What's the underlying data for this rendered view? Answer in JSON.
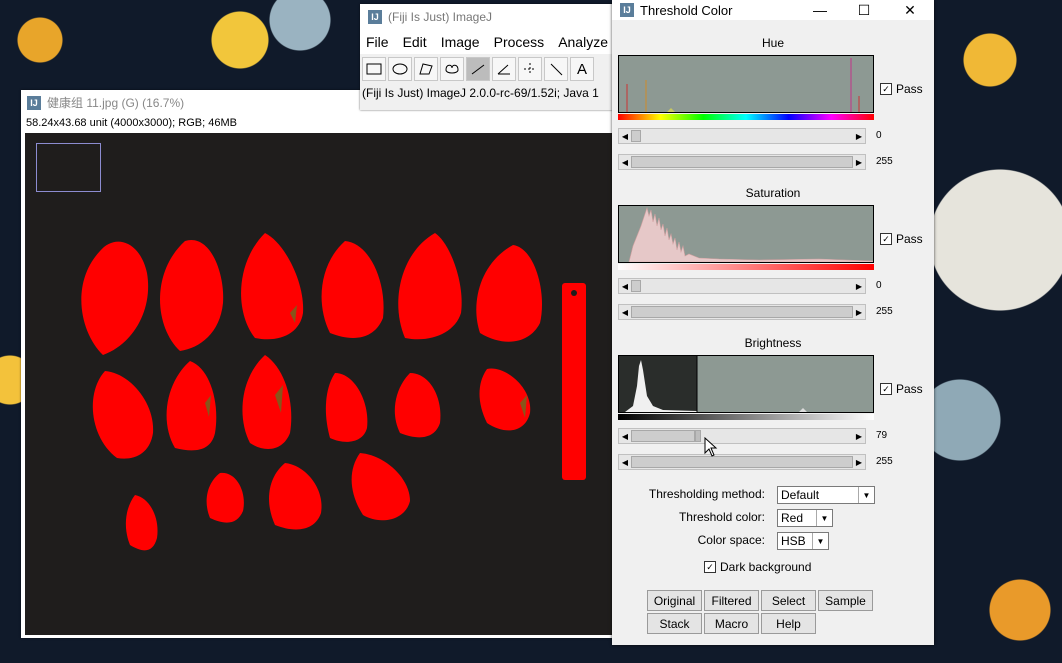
{
  "image_window": {
    "title": "健康组 11.jpg (G) (16.7%)",
    "info": "58.24x43.68 unit (4000x3000); RGB; 46MB"
  },
  "imagej_window": {
    "title": "(Fiji Is Just) ImageJ",
    "menu": [
      "File",
      "Edit",
      "Image",
      "Process",
      "Analyze"
    ],
    "status": "(Fiji Is Just) ImageJ 2.0.0-rc-69/1.52i; Java 1"
  },
  "threshold_window": {
    "title": "Threshold Color",
    "hue": {
      "label": "Hue",
      "min": "0",
      "max": "255",
      "pass_label": "Pass",
      "pass": true
    },
    "saturation": {
      "label": "Saturation",
      "min": "0",
      "max": "255",
      "pass_label": "Pass",
      "pass": true
    },
    "brightness": {
      "label": "Brightness",
      "min": "79",
      "max": "255",
      "pass_label": "Pass",
      "pass": true
    },
    "method_label": "Thresholding method:",
    "method_value": "Default",
    "color_label": "Threshold color:",
    "color_value": "Red",
    "space_label": "Color space:",
    "space_value": "HSB",
    "dark_bg_label": "Dark background",
    "dark_bg": true,
    "buttons_row1": [
      "Original",
      "Filtered",
      "Select",
      "Sample"
    ],
    "buttons_row2": [
      "Stack",
      "Macro",
      "Help"
    ]
  },
  "colors": {
    "threshold_red": "#ff0000",
    "histogram_bg": "#8d9993"
  }
}
